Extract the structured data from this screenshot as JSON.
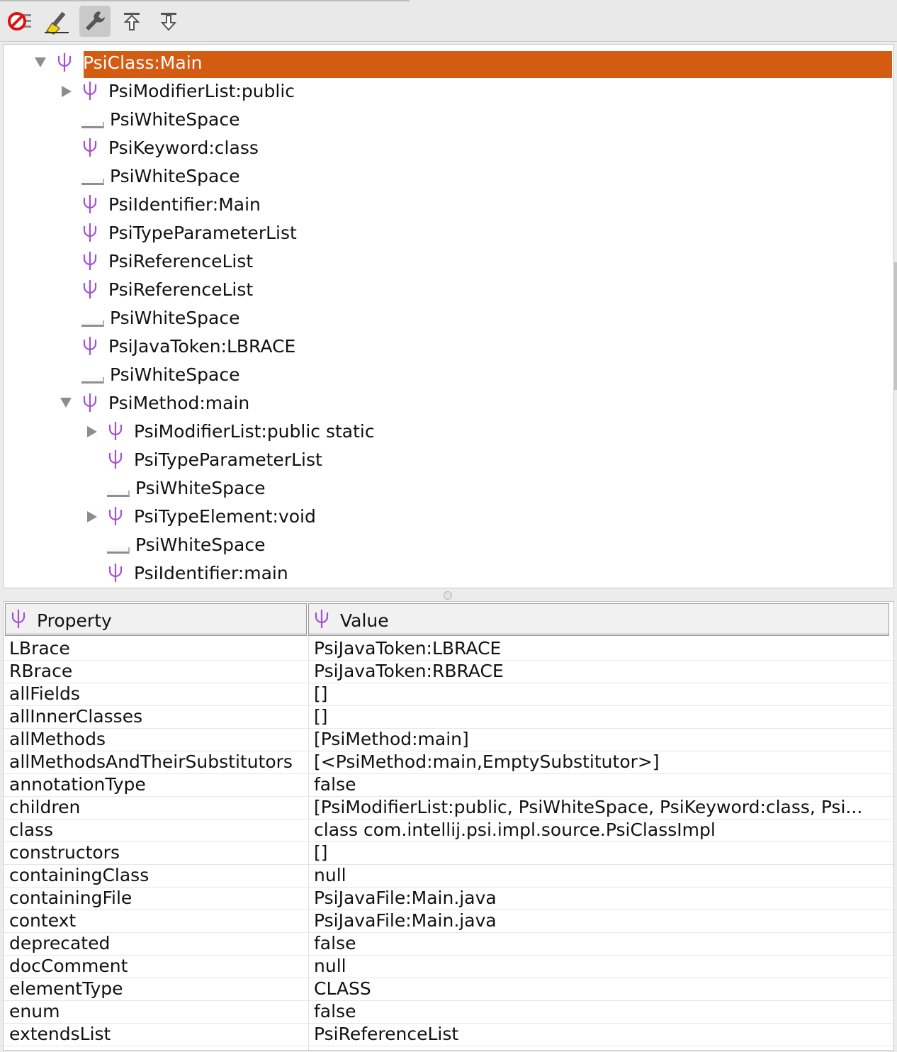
{
  "toolbar": {
    "buttons": [
      {
        "name": "cancel-button",
        "icon": "no-entry-icon"
      },
      {
        "name": "highlight-button",
        "icon": "brush-icon"
      },
      {
        "name": "settings-button",
        "icon": "wrench-icon",
        "active": true
      },
      {
        "name": "move-up-button",
        "icon": "arrow-up-icon"
      },
      {
        "name": "move-down-button",
        "icon": "arrow-down-icon"
      }
    ]
  },
  "tree": {
    "selected_color": "#d35b12",
    "icon_color": "#a34fd6",
    "nodes": [
      {
        "label": "PsiClass:Main",
        "depth": 0,
        "expander": "expanded",
        "icon": "psi",
        "selected": true
      },
      {
        "label": "PsiModifierList:public",
        "depth": 1,
        "expander": "collapsed",
        "icon": "psi"
      },
      {
        "label": "PsiWhiteSpace",
        "depth": 1,
        "expander": "none",
        "icon": "whitespace"
      },
      {
        "label": "PsiKeyword:class",
        "depth": 1,
        "expander": "none",
        "icon": "psi"
      },
      {
        "label": "PsiWhiteSpace",
        "depth": 1,
        "expander": "none",
        "icon": "whitespace"
      },
      {
        "label": "PsiIdentifier:Main",
        "depth": 1,
        "expander": "none",
        "icon": "psi"
      },
      {
        "label": "PsiTypeParameterList",
        "depth": 1,
        "expander": "none",
        "icon": "psi"
      },
      {
        "label": "PsiReferenceList",
        "depth": 1,
        "expander": "none",
        "icon": "psi"
      },
      {
        "label": "PsiReferenceList",
        "depth": 1,
        "expander": "none",
        "icon": "psi"
      },
      {
        "label": "PsiWhiteSpace",
        "depth": 1,
        "expander": "none",
        "icon": "whitespace"
      },
      {
        "label": "PsiJavaToken:LBRACE",
        "depth": 1,
        "expander": "none",
        "icon": "psi"
      },
      {
        "label": "PsiWhiteSpace",
        "depth": 1,
        "expander": "none",
        "icon": "whitespace"
      },
      {
        "label": "PsiMethod:main",
        "depth": 1,
        "expander": "expanded",
        "icon": "psi"
      },
      {
        "label": "PsiModifierList:public static",
        "depth": 2,
        "expander": "collapsed",
        "icon": "psi"
      },
      {
        "label": "PsiTypeParameterList",
        "depth": 2,
        "expander": "none",
        "icon": "psi"
      },
      {
        "label": "PsiWhiteSpace",
        "depth": 2,
        "expander": "none",
        "icon": "whitespace"
      },
      {
        "label": "PsiTypeElement:void",
        "depth": 2,
        "expander": "collapsed",
        "icon": "psi"
      },
      {
        "label": "PsiWhiteSpace",
        "depth": 2,
        "expander": "none",
        "icon": "whitespace"
      },
      {
        "label": "PsiIdentifier:main",
        "depth": 2,
        "expander": "none",
        "icon": "psi"
      }
    ]
  },
  "table": {
    "headers": {
      "property": "Property",
      "value": "Value"
    },
    "rows": [
      {
        "property": "LBrace",
        "value": "PsiJavaToken:LBRACE"
      },
      {
        "property": "RBrace",
        "value": "PsiJavaToken:RBRACE"
      },
      {
        "property": "allFields",
        "value": "[]"
      },
      {
        "property": "allInnerClasses",
        "value": "[]"
      },
      {
        "property": "allMethods",
        "value": "[PsiMethod:main]"
      },
      {
        "property": "allMethodsAndTheirSubstitutors",
        "value": "[<PsiMethod:main,EmptySubstitutor>]"
      },
      {
        "property": "annotationType",
        "value": "false"
      },
      {
        "property": "children",
        "value": "[PsiModifierList:public, PsiWhiteSpace, PsiKeyword:class, Psi..."
      },
      {
        "property": "class",
        "value": "class com.intellij.psi.impl.source.PsiClassImpl"
      },
      {
        "property": "constructors",
        "value": "[]"
      },
      {
        "property": "containingClass",
        "value": "null"
      },
      {
        "property": "containingFile",
        "value": "PsiJavaFile:Main.java"
      },
      {
        "property": "context",
        "value": "PsiJavaFile:Main.java"
      },
      {
        "property": "deprecated",
        "value": "false"
      },
      {
        "property": "docComment",
        "value": "null"
      },
      {
        "property": "elementType",
        "value": "CLASS"
      },
      {
        "property": "enum",
        "value": "false"
      },
      {
        "property": "extendsList",
        "value": "PsiReferenceList"
      }
    ]
  }
}
